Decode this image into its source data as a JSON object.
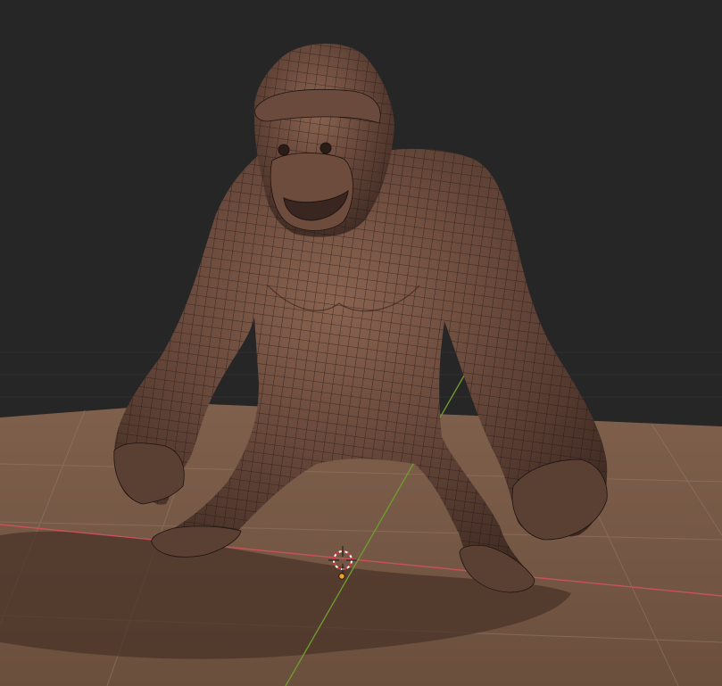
{
  "viewport": {
    "background_color": "#262626",
    "floor_color": "#7a5c49",
    "floor_shadow_color": "#4a3428",
    "grid_color": "#8f7362",
    "x_axis_color": "#c9525a",
    "y_axis_color": "#6f9a2e",
    "model_color": "#5e4135",
    "model_highlight_color": "#8a6350",
    "wireframe_color": "#1f1410"
  },
  "scene": {
    "object_name": "gorilla-mesh",
    "shading": "solid",
    "overlay": "wireframe",
    "cursor_icon": "3d-cursor-icon",
    "origin_icon": "object-origin-icon"
  }
}
